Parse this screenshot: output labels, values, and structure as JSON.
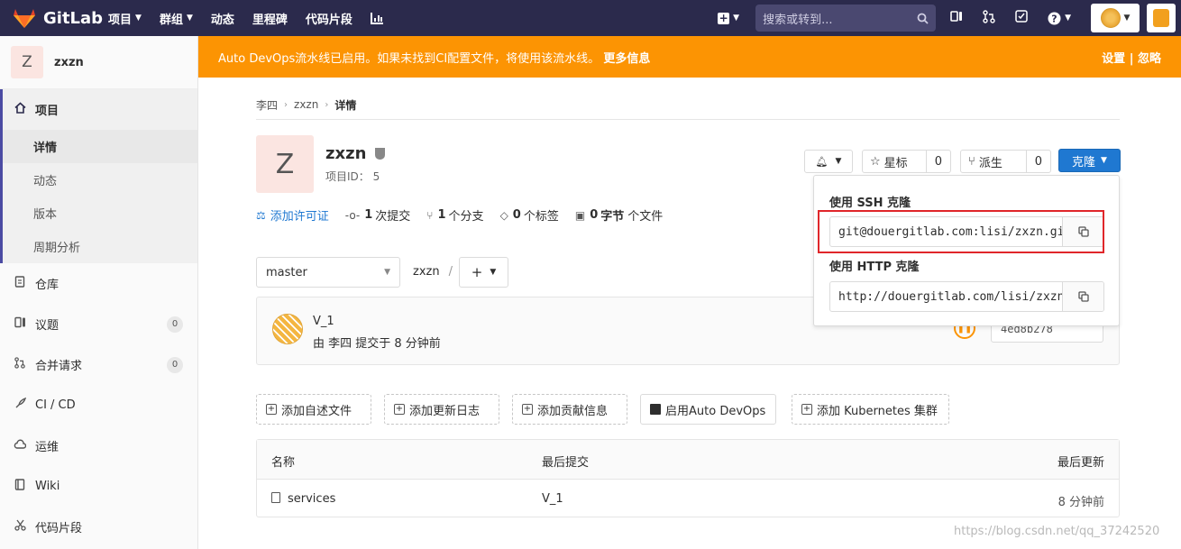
{
  "topnav": {
    "brand": "GitLab",
    "links": [
      {
        "label": "项目",
        "caret": true
      },
      {
        "label": "群组",
        "caret": true
      },
      {
        "label": "动态",
        "caret": false
      },
      {
        "label": "里程碑",
        "caret": false
      },
      {
        "label": "代码片段",
        "caret": false
      }
    ],
    "search_placeholder": "搜索或转到...",
    "icons": [
      "plus-icon",
      "search-icon",
      "panel-icon",
      "merge-request-icon",
      "todo-icon",
      "help-icon",
      "user-avatar",
      "helper-icon"
    ]
  },
  "sidebar": {
    "project_initial": "Z",
    "project_name": "zxzn",
    "items": [
      {
        "label": "项目",
        "icon": "home-icon"
      },
      {
        "label": "仓库",
        "icon": "doc-icon"
      },
      {
        "label": "议题",
        "icon": "issues-icon",
        "badge": "0"
      },
      {
        "label": "合并请求",
        "icon": "merge-request-icon",
        "badge": "0"
      },
      {
        "label": "CI / CD",
        "icon": "rocket-icon"
      },
      {
        "label": "运维",
        "icon": "cloud-icon"
      },
      {
        "label": "Wiki",
        "icon": "book-icon"
      },
      {
        "label": "代码片段",
        "icon": "scissors-icon"
      }
    ],
    "subitems": [
      "详情",
      "动态",
      "版本",
      "周期分析"
    ]
  },
  "banner": {
    "message": "Auto DevOps流水线已启用。如果未找到CI配置文件，将使用该流水线。",
    "more": "更多信息",
    "settings": "设置",
    "divider": "|",
    "ignore": "忽略"
  },
  "breadcrumb": [
    "李四",
    "zxzn",
    "详情"
  ],
  "project": {
    "initial": "Z",
    "name": "zxzn",
    "id_label": "项目ID： 5",
    "license": "添加许可证",
    "commits_count": "1",
    "commits_label": "次提交",
    "branches_count": "1",
    "branches_label": "个分支",
    "tags_count": "0",
    "tags_label": "个标签",
    "size_count": "0",
    "size_label": "字节",
    "files_label": "个文件"
  },
  "actions": {
    "star_label": "星标",
    "star_count": "0",
    "fork_label": "派生",
    "fork_count": "0",
    "clone_label": "克隆"
  },
  "repo_bar": {
    "branch": "master",
    "path": "zxzn",
    "slash": "/",
    "add": "+"
  },
  "commit": {
    "title": "V_1",
    "meta": "由 李四 提交于 8 分钟前",
    "sha": "4ed8b278",
    "pipeline_icon": "pause-icon"
  },
  "quick_actions": [
    {
      "label": "添加自述文件"
    },
    {
      "label": "添加更新日志"
    },
    {
      "label": "添加贡献信息"
    },
    {
      "label": "启用Auto DevOps"
    },
    {
      "label": "添加 Kubernetes 集群"
    }
  ],
  "file_table": {
    "headers": [
      "名称",
      "最后提交",
      "最后更新"
    ],
    "rows": [
      {
        "name": "services",
        "last_commit": "V_1",
        "updated": "8 分钟前"
      }
    ]
  },
  "clone_dropdown": {
    "ssh_title": "使用 SSH 克隆",
    "ssh_url": "git@douergitlab.com:lisi/zxzn.git",
    "http_title": "使用 HTTP 克隆",
    "http_url": "http://douergitlab.com/lisi/zxzn.git"
  },
  "watermark": "https://blog.csdn.net/qq_37242520",
  "colors": {
    "nav_bg": "#2b2a4c",
    "banner_bg": "#fc9403",
    "primary": "#1f78d1",
    "highlight_box": "#e0262a"
  }
}
